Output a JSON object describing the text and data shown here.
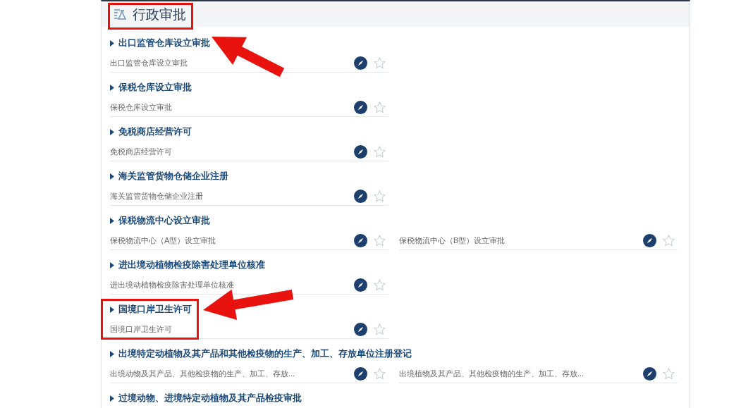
{
  "section": {
    "title": "行政审批"
  },
  "items": [
    {
      "title": "出口监管仓库设立审批",
      "entries": [
        {
          "label": "出口监管仓库设立审批"
        }
      ]
    },
    {
      "title": "保税仓库设立审批",
      "entries": [
        {
          "label": "保税仓库设立审批"
        }
      ]
    },
    {
      "title": "免税商店经营许可",
      "entries": [
        {
          "label": "免税商店经营许可"
        }
      ]
    },
    {
      "title": "海关监管货物仓储企业注册",
      "entries": [
        {
          "label": "海关监管货物仓储企业注册"
        }
      ]
    },
    {
      "title": "保税物流中心设立审批",
      "entries": [
        {
          "label": "保税物流中心（A型）设立审批"
        },
        {
          "label": "保税物流中心（B型）设立审批"
        }
      ]
    },
    {
      "title": "进出境动植物检疫除害处理单位核准",
      "entries": [
        {
          "label": "进出境动植物检疫除害处理单位核准"
        }
      ]
    },
    {
      "title": "国境口岸卫生许可",
      "entries": [
        {
          "label": "国境口岸卫生许可"
        }
      ]
    },
    {
      "title": "出境特定动植物及其产品和其他检疫物的生产、加工、存放单位注册登记",
      "entries": [
        {
          "label": "出境动物及其产品、其他检疫物的生产、加工、存放..."
        },
        {
          "label": "出境植物及其产品、其他检疫物的生产、加工、存放..."
        }
      ]
    },
    {
      "title": "过境动物、进境特定动植物及其产品检疫审批"
    }
  ]
}
